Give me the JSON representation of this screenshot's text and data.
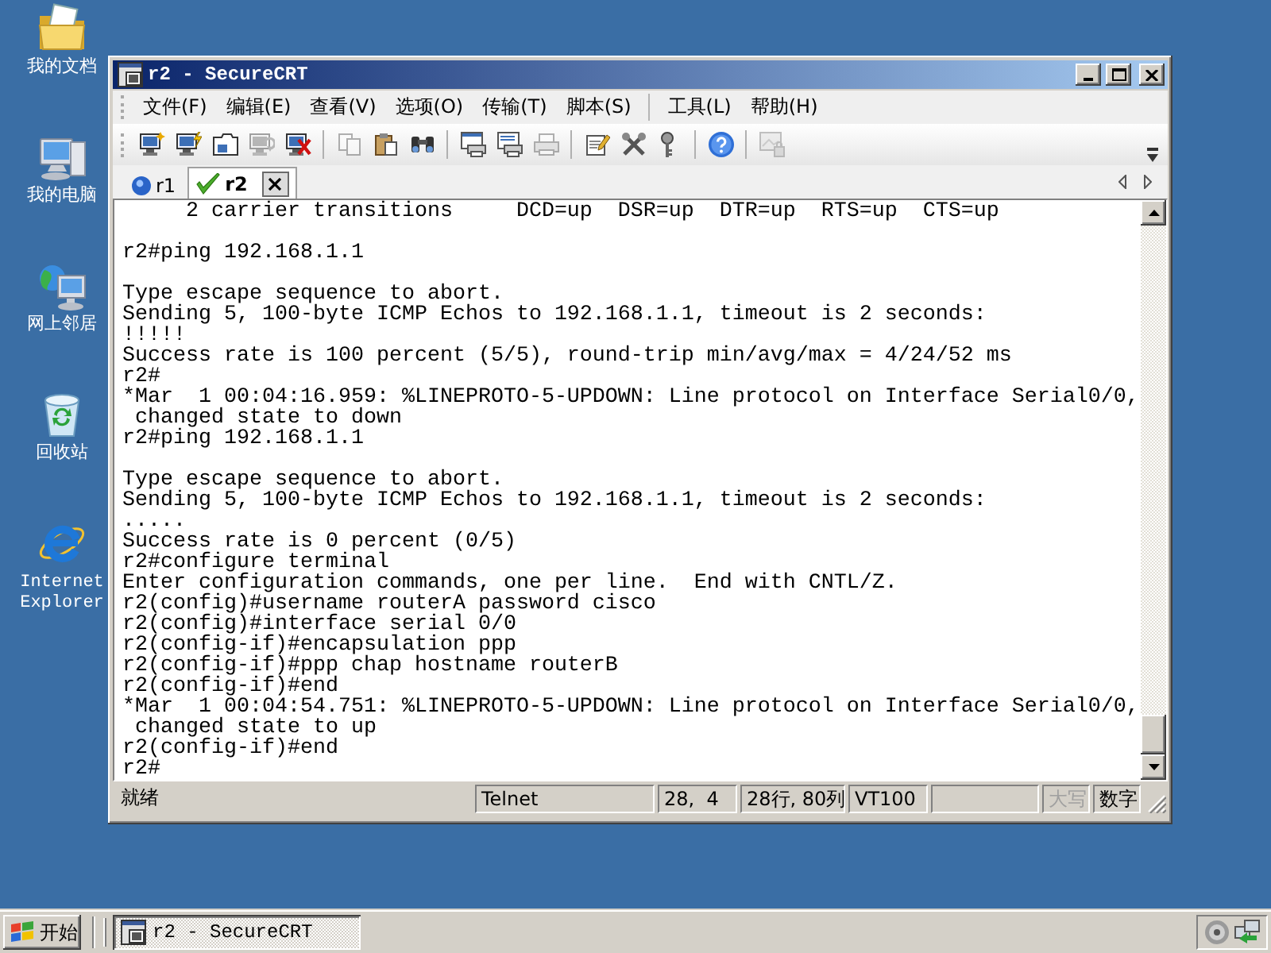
{
  "desktop": {
    "icons": [
      {
        "label": "我的文档",
        "kind": "documents"
      },
      {
        "label": "我的电脑",
        "kind": "computer"
      },
      {
        "label": "网上邻居",
        "kind": "network"
      },
      {
        "label": "回收站",
        "kind": "recyclebin"
      },
      {
        "label": "Internet Explorer",
        "kind": "browser"
      }
    ]
  },
  "window": {
    "title": "r2 - SecureCRT",
    "menu_groups": [
      [
        "文件(F)",
        "编辑(E)",
        "查看(V)",
        "选项(O)",
        "传输(T)",
        "脚本(S)"
      ],
      [
        "工具(L)",
        "帮助(H)"
      ]
    ],
    "toolbar_groups": [
      [
        {
          "kind": "connect",
          "disabled": false
        },
        {
          "kind": "quickconnect",
          "disabled": false
        },
        {
          "kind": "tabconnect",
          "disabled": false
        },
        {
          "kind": "reconnect",
          "disabled": true
        },
        {
          "kind": "disconnect",
          "disabled": false
        }
      ],
      [
        {
          "kind": "copy",
          "disabled": true
        },
        {
          "kind": "paste",
          "disabled": false
        },
        {
          "kind": "find",
          "disabled": false
        }
      ],
      [
        {
          "kind": "printscreen",
          "disabled": false
        },
        {
          "kind": "printselection",
          "disabled": false
        },
        {
          "kind": "print",
          "disabled": true
        }
      ],
      [
        {
          "kind": "sessionoptions",
          "disabled": false
        },
        {
          "kind": "globaloptions",
          "disabled": false
        },
        {
          "kind": "keygen",
          "disabled": false
        }
      ],
      [
        {
          "kind": "help",
          "disabled": false
        }
      ],
      [
        {
          "kind": "lockscreen",
          "disabled": true
        }
      ]
    ],
    "tabs": [
      {
        "label": "r1",
        "connected": false,
        "selected": false
      },
      {
        "label": "r2",
        "connected": true,
        "selected": true
      }
    ],
    "terminal": {
      "blocks": [
        [
          "     2 carrier transitions     DCD=up  DSR=up  DTR=up  RTS=up  CTS=up"
        ],
        [
          "r2#ping 192.168.1.1"
        ],
        [
          "Type escape sequence to abort.",
          "Sending 5, 100-byte ICMP Echos to 192.168.1.1, timeout is 2 seconds:",
          "!!!!!",
          "Success rate is 100 percent (5/5), round-trip min/avg/max = 4/24/52 ms",
          "r2#",
          "*Mar  1 00:04:16.959: %LINEPROTO-5-UPDOWN: Line protocol on Interface Serial0/0,",
          " changed state to down",
          "r2#ping 192.168.1.1"
        ],
        [
          "Type escape sequence to abort.",
          "Sending 5, 100-byte ICMP Echos to 192.168.1.1, timeout is 2 seconds:",
          ".....",
          "Success rate is 0 percent (0/5)",
          "r2#configure terminal",
          "Enter configuration commands, one per line.  End with CNTL/Z.",
          "r2(config)#username routerA password cisco",
          "r2(config)#interface serial 0/0",
          "r2(config-if)#encapsulation ppp",
          "r2(config-if)#ppp chap hostname routerB",
          "r2(config-if)#end",
          "*Mar  1 00:04:54.751: %LINEPROTO-5-UPDOWN: Line protocol on Interface Serial0/0,",
          " changed state to up",
          "r2(config-if)#end",
          "r2#"
        ]
      ]
    },
    "status_bar": {
      "message": "就绪",
      "panels": [
        {
          "kind": "text",
          "text": "Telnet"
        },
        {
          "kind": "text",
          "text": "28,  4"
        },
        {
          "kind": "text",
          "text": "28行, 80列"
        },
        {
          "kind": "text",
          "text": "VT100"
        },
        {
          "kind": "blank"
        },
        {
          "kind": "key",
          "text": "大写",
          "on": false
        },
        {
          "kind": "key",
          "text": "数字",
          "on": true
        }
      ]
    }
  },
  "taskbar": {
    "start": "开始",
    "tasks": [
      {
        "label": "r2 - SecureCRT",
        "selected": true
      }
    ]
  }
}
